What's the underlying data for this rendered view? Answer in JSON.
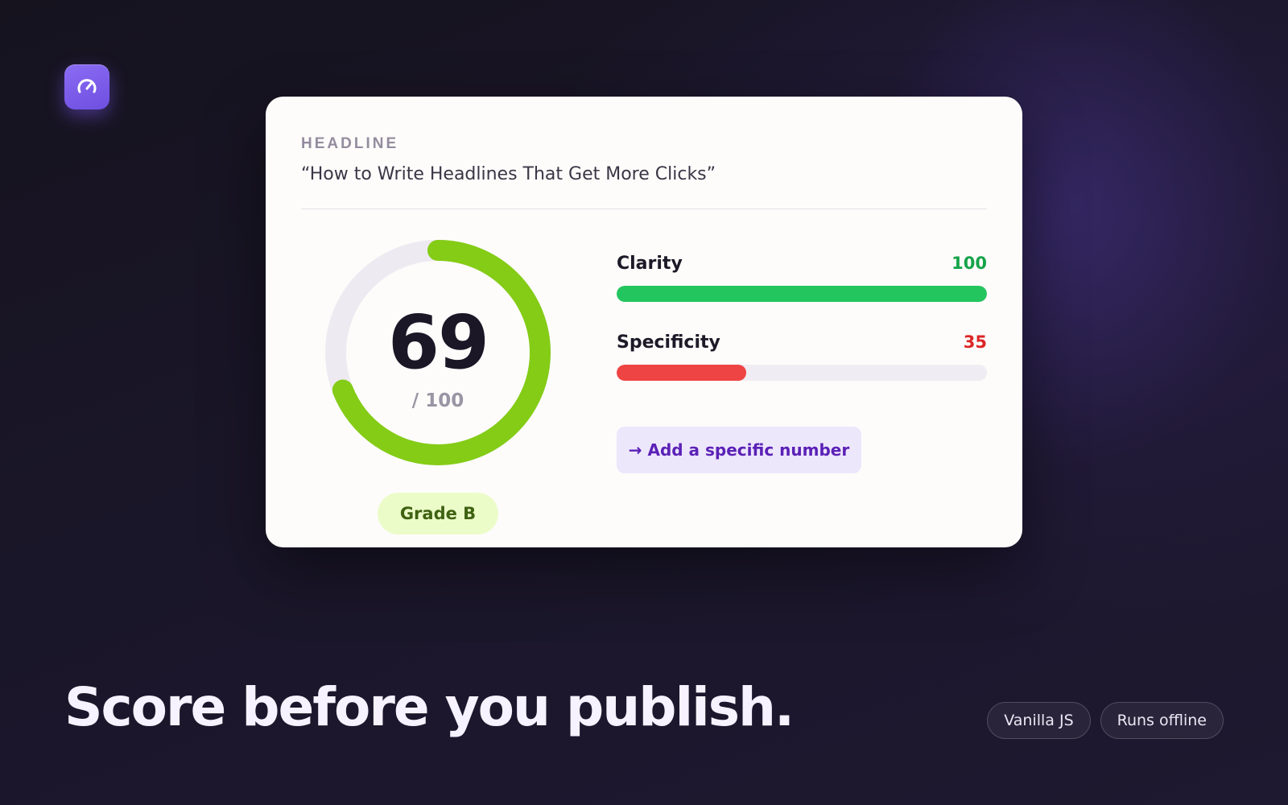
{
  "headline": {
    "label": "HEADLINE",
    "text": "“How to Write Headlines That Get More Clicks”"
  },
  "score": {
    "value": "69",
    "max_label": "/ 100",
    "fraction": 0.69,
    "ring_color": "#84cc16",
    "track_color": "#edeaf1"
  },
  "grade": {
    "label": "Grade B"
  },
  "metrics": [
    {
      "label": "Clarity",
      "value": "100",
      "fraction": 1.0,
      "color": "#22c55e",
      "value_color": "#16a34a"
    },
    {
      "label": "Specificity",
      "value": "35",
      "fraction": 0.35,
      "color": "#ef4444",
      "value_color": "#dc2626"
    }
  ],
  "tip": {
    "label": "→ Add a specific number"
  },
  "tagline": "Score before you publish.",
  "chips": [
    "Vanilla JS",
    "Runs offline"
  ],
  "icons": {
    "app": "speedometer-icon"
  }
}
